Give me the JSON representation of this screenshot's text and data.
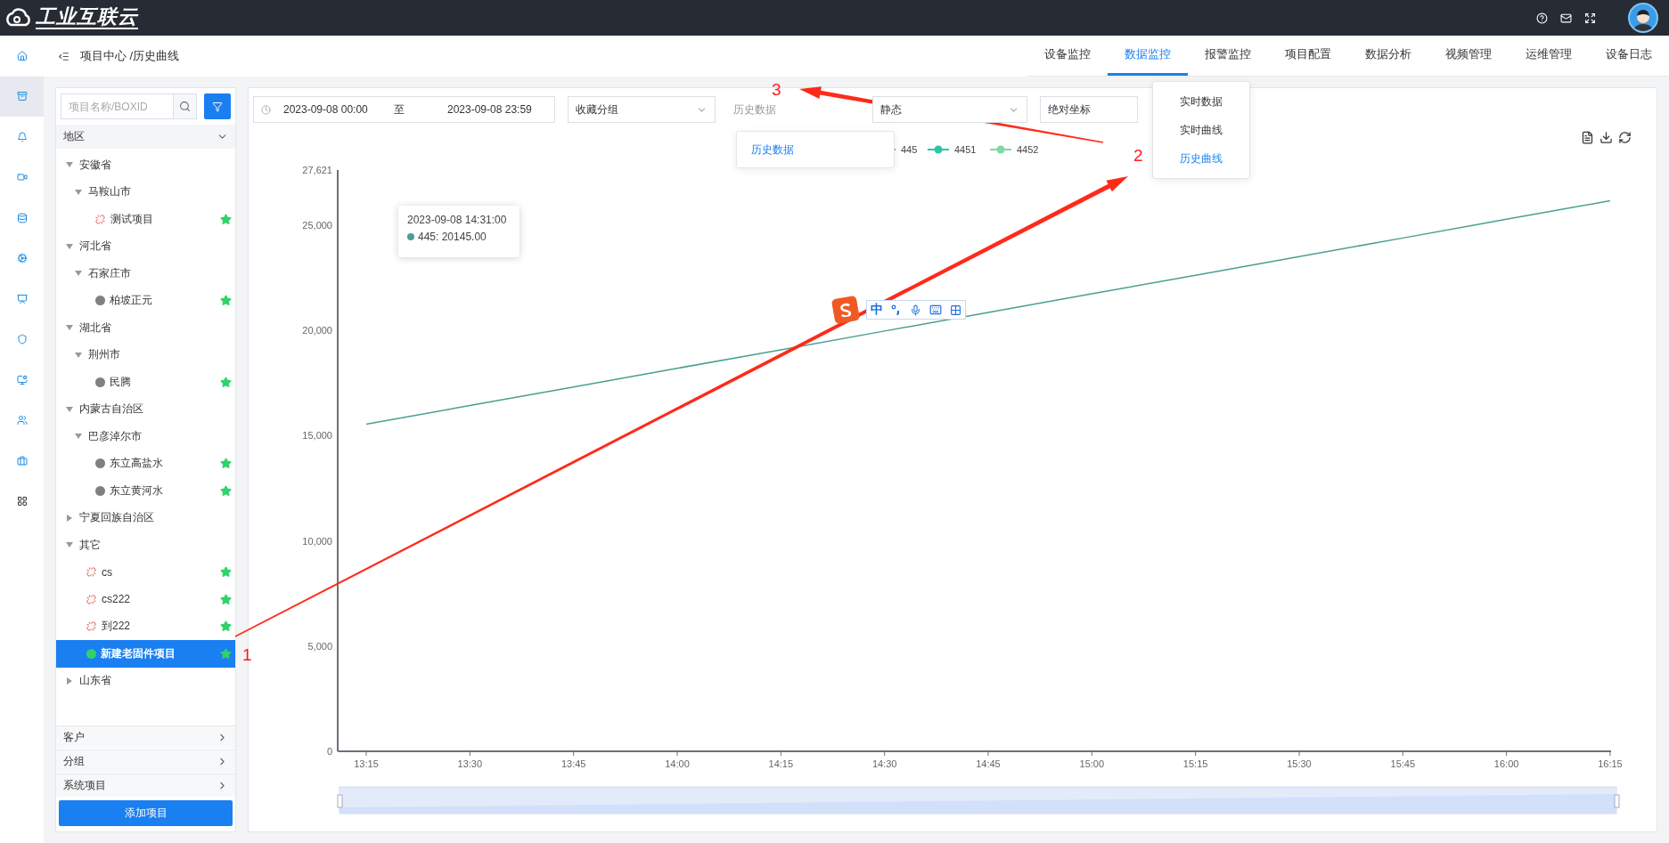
{
  "header": {
    "logo_text": "工业互联云"
  },
  "breadcrumb": "项目中心 /历史曲线",
  "icon_sidebar": [
    {
      "selected": false
    },
    {
      "selected": true
    },
    {
      "selected": false
    },
    {
      "selected": false
    },
    {
      "selected": false
    },
    {
      "selected": false
    },
    {
      "selected": false
    },
    {
      "selected": false
    },
    {
      "selected": false
    },
    {
      "selected": false
    },
    {
      "selected": false
    },
    {
      "selected": false
    }
  ],
  "nav_tabs": [
    {
      "label": "设备监控",
      "selected": false
    },
    {
      "label": "数据监控",
      "selected": true
    },
    {
      "label": "报警监控",
      "selected": false
    },
    {
      "label": "项目配置",
      "selected": false
    },
    {
      "label": "数据分析",
      "selected": false
    },
    {
      "label": "视频管理",
      "selected": false
    },
    {
      "label": "运维管理",
      "selected": false
    },
    {
      "label": "设备日志",
      "selected": false
    }
  ],
  "nav_menu": [
    {
      "label": "实时数据",
      "selected": false
    },
    {
      "label": "实时曲线",
      "selected": false
    },
    {
      "label": "历史曲线",
      "selected": true
    }
  ],
  "project_panel": {
    "search": {
      "placeholder": "项目名称/BOXID"
    },
    "section": "地区",
    "tree": [
      {
        "label": "安徽省",
        "expanded": true,
        "children": [
          {
            "label": "马鞍山市",
            "expanded": true,
            "children": [
              {
                "label": "测试项目",
                "kind": "link",
                "starred": true,
                "selected": false
              }
            ]
          }
        ]
      },
      {
        "label": "河北省",
        "expanded": true,
        "children": [
          {
            "label": "石家庄市",
            "expanded": true,
            "children": [
              {
                "label": "柏坡正元",
                "kind": "dot",
                "color": "#808080",
                "starred": true,
                "selected": false
              }
            ]
          }
        ]
      },
      {
        "label": "湖北省",
        "expanded": true,
        "children": [
          {
            "label": "荆州市",
            "expanded": true,
            "children": [
              {
                "label": "民腾",
                "kind": "dot",
                "color": "#808080",
                "starred": true,
                "selected": false
              }
            ]
          }
        ]
      },
      {
        "label": "内蒙古自治区",
        "expanded": true,
        "children": [
          {
            "label": "巴彦淖尔市",
            "expanded": true,
            "children": [
              {
                "label": "东立高盐水",
                "kind": "dot",
                "color": "#808080",
                "starred": true,
                "selected": false
              },
              {
                "label": "东立黄河水",
                "kind": "dot",
                "color": "#808080",
                "starred": true,
                "selected": false
              }
            ]
          }
        ]
      },
      {
        "label": "宁夏回族自治区",
        "expanded": false
      },
      {
        "label": "其它",
        "expanded": true,
        "children": [
          {
            "label": "cs",
            "kind": "link",
            "starred": true,
            "selected": false
          },
          {
            "label": "cs222",
            "kind": "link",
            "starred": true,
            "selected": false
          },
          {
            "label": "到222",
            "kind": "link",
            "starred": true,
            "selected": false
          },
          {
            "label": "新建老固件项目",
            "kind": "dot",
            "color": "#2fd36a",
            "starred": true,
            "selected": true
          }
        ]
      },
      {
        "label": "山东省",
        "expanded": false
      }
    ],
    "groups": [
      "客户",
      "分组",
      "系统项目"
    ],
    "add_button": "添加项目"
  },
  "filters": {
    "date_start": "2023-09-08 00:00",
    "date_separator": "至",
    "date_end": "2023-09-08 23:59",
    "favorite_group": "收藏分组",
    "data_type": "历史数据",
    "mode": "静态",
    "coordinate": "绝对坐标",
    "popover_item": "历史数据"
  },
  "chart": {
    "tooltip": {
      "time": "2023-09-08 14:31:00",
      "entry": "445: 20145.00",
      "color": "#4a9f92"
    },
    "chart_data": {
      "type": "line",
      "x": [
        "13:15",
        "13:30",
        "13:45",
        "14:00",
        "14:15",
        "14:30",
        "14:45",
        "15:00",
        "15:15",
        "15:30",
        "15:45",
        "16:00",
        "16:15"
      ],
      "ylim": [
        0,
        27621
      ],
      "yticks": [
        {
          "value": 0,
          "label": "0"
        },
        {
          "value": 5000,
          "label": "5,000"
        },
        {
          "value": 10000,
          "label": "10,000"
        },
        {
          "value": 15000,
          "label": "15,000"
        },
        {
          "value": 20000,
          "label": "20,000"
        },
        {
          "value": 25000,
          "label": "25,000"
        },
        {
          "value": 27621,
          "label": "27,621"
        }
      ],
      "series": [
        {
          "name": "445",
          "color": "#4a9f92",
          "values": [
            15540,
            16430,
            17310,
            18200,
            19080,
            19970,
            20850,
            21740,
            22620,
            23510,
            24390,
            25280,
            26160
          ]
        },
        {
          "name": "4451",
          "color": "#2ec4a6",
          "values": [
            null,
            null,
            null,
            null,
            null,
            null,
            null,
            null,
            null,
            null,
            null,
            null,
            null
          ]
        },
        {
          "name": "4452",
          "color": "#7fd8a6",
          "values": [
            null,
            null,
            null,
            null,
            null,
            null,
            null,
            null,
            null,
            null,
            null,
            null,
            null
          ]
        }
      ]
    }
  },
  "ime_toolbar": {
    "mode": "中"
  },
  "annotations": [
    "1",
    "2",
    "3"
  ]
}
